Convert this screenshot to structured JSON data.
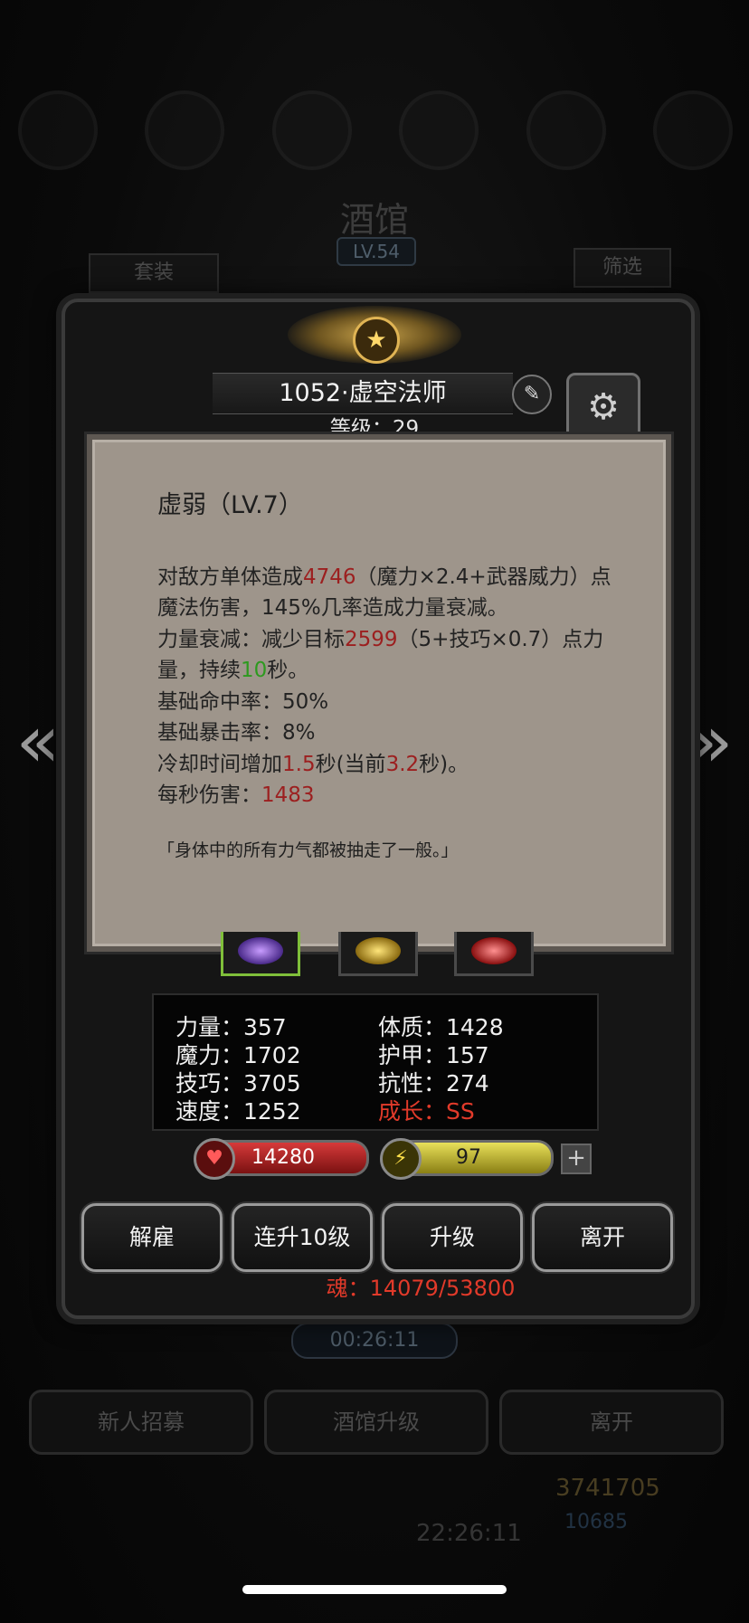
{
  "background": {
    "tavern_title": "酒馆",
    "tavern_level": "LV.54",
    "set_button": "套装",
    "filter_button": "筛选",
    "timer": "00:26:11",
    "recruit_button": "新人招募",
    "upgrade_tavern_button": "酒馆升级",
    "leave_button": "离开",
    "gold": "3741705",
    "gems": "10685",
    "clock": "22:26:11"
  },
  "hero": {
    "name": "1052·虚空法师",
    "level_text": "等级：29"
  },
  "skill_tooltip": {
    "title": "虚弱（LV.7）",
    "desc_part1": "对敌方单体造成",
    "damage": "4746",
    "desc_part2": "（魔力×2.4+武器威力）点魔法伤害，145%几率造成力量衰减。",
    "debuff_part1": "力量衰减：减少目标",
    "debuff_value": "2599",
    "debuff_part2": "（5+技巧×0.7）点力量，持续",
    "duration": "10",
    "debuff_part3": "秒。",
    "hit_rate": "基础命中率：50%",
    "crit_rate": "基础暴击率：8%",
    "cooldown_part1": "冷却时间增加",
    "cooldown_add": "1.5",
    "cooldown_part2": "秒(当前",
    "cooldown_current": "3.2",
    "cooldown_part3": "秒)。",
    "dps_label": "每秒伤害：",
    "dps_value": "1483",
    "quote": "「身体中的所有力气都被抽走了一般。」"
  },
  "stats": {
    "strength": "力量：357",
    "magic": "魔力：1702",
    "skill": "技巧：3705",
    "speed": "速度：1252",
    "constitution": "体质：1428",
    "armor": "护甲：157",
    "resistance": "抗性：274",
    "growth": "成长：SS"
  },
  "bars": {
    "hp": "14280",
    "energy": "97"
  },
  "actions": {
    "dismiss": "解雇",
    "level_up_10": "连升10级",
    "level_up": "升级",
    "leave": "离开"
  },
  "soul": "魂：14079/53800",
  "colors": {
    "damage_red": "#9c1f1f",
    "duration_green": "#2d9a1f",
    "growth_red": "#e23a2a",
    "tooltip_bg": "#9e958b"
  }
}
